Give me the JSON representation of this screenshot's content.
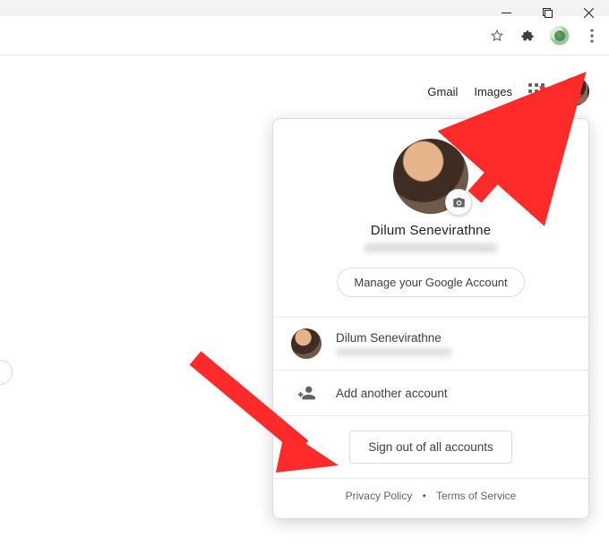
{
  "nav": {
    "gmail": "Gmail",
    "images": "Images"
  },
  "account": {
    "display_name": "Dilum Senevirathne",
    "manage_label": "Manage your Google Account",
    "secondary_name": "Dilum Senevirathne",
    "add_account_label": "Add another account",
    "signout_label": "Sign out of all accounts",
    "privacy_label": "Privacy Policy",
    "terms_label": "Terms of Service"
  }
}
